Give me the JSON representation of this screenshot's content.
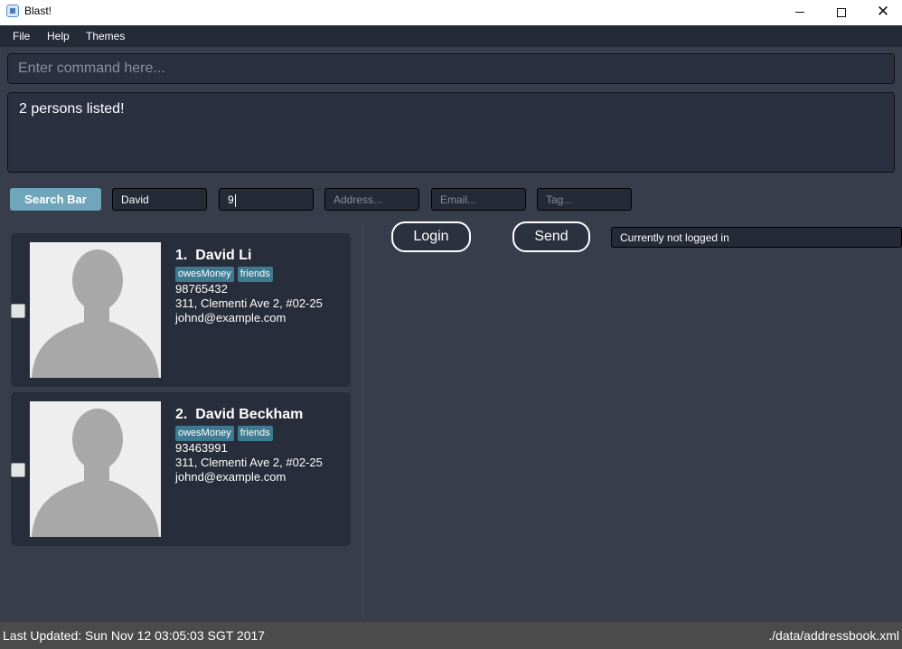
{
  "window": {
    "title": "Blast!"
  },
  "menu": {
    "items": [
      "File",
      "Help",
      "Themes"
    ]
  },
  "command": {
    "placeholder": "Enter command here..."
  },
  "result": {
    "text": "2 persons listed!"
  },
  "search": {
    "label": "Search Bar",
    "fields": [
      {
        "value": "David",
        "placeholder": ""
      },
      {
        "value": "9",
        "placeholder": ""
      },
      {
        "value": "",
        "placeholder": "Address..."
      },
      {
        "value": "",
        "placeholder": "Email..."
      },
      {
        "value": "",
        "placeholder": "Tag..."
      }
    ]
  },
  "persons": [
    {
      "index": "1.",
      "name": "David Li",
      "tags": [
        "owesMoney",
        "friends"
      ],
      "phone": "98765432",
      "address": "311, Clementi Ave 2, #02-25",
      "email": "johnd@example.com"
    },
    {
      "index": "2.",
      "name": "David Beckham",
      "tags": [
        "owesMoney",
        "friends"
      ],
      "phone": "93463991",
      "address": "311, Clementi Ave 2, #02-25",
      "email": "johnd@example.com"
    }
  ],
  "actions": {
    "login_label": "Login",
    "send_label": "Send",
    "login_status": "Currently not logged in"
  },
  "status": {
    "last_updated": "Last Updated: Sun Nov 12 03:05:03 SGT 2017",
    "file_path": "./data/addressbook.xml"
  },
  "colors": {
    "accent": "#6fa6bb",
    "tag": "#3e7b91",
    "background": "#383d4c",
    "card": "#282d3b"
  },
  "icons": {
    "avatar": "person-silhouette-icon",
    "close": "close-icon",
    "minimize": "minimize-icon",
    "maximize": "maximize-icon"
  }
}
